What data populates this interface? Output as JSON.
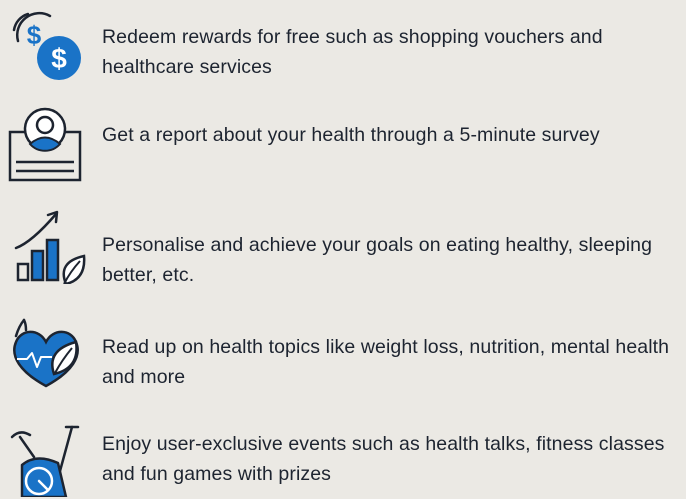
{
  "colors": {
    "background": "#ebe9e4",
    "text": "#1d2430",
    "accent": "#1a73c7",
    "icon_outline": "#1d2430"
  },
  "features": [
    {
      "icon": "dollar-coins-icon",
      "text": "Redeem rewards for free such as shopping vouchers and healthcare services"
    },
    {
      "icon": "health-report-icon",
      "text": "Get a report about your health through a 5-minute survey"
    },
    {
      "icon": "growth-chart-leaf-icon",
      "text": "Personalise and achieve your goals on eating healthy, sleeping better, etc."
    },
    {
      "icon": "heart-leaf-icon",
      "text": "Read up on health topics like weight loss, nutrition, mental health and more"
    },
    {
      "icon": "exercise-bike-icon",
      "text": "Enjoy user-exclusive events such as health talks, fitness classes and fun games with prizes"
    }
  ]
}
